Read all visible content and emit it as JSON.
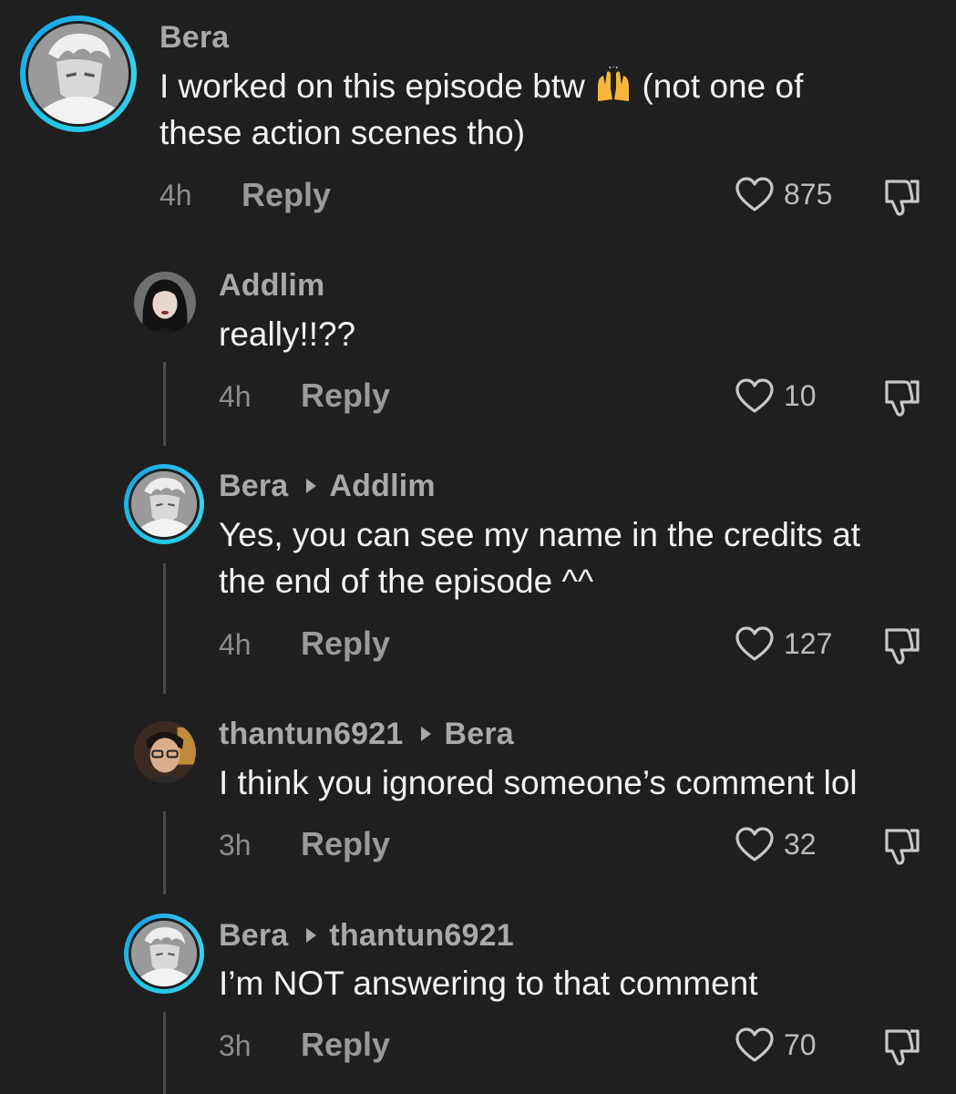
{
  "comments": [
    {
      "user": "Bera",
      "reply_to": "",
      "text_line1": "I worked on this episode btw",
      "emoji": "raising-hands-emoji",
      "text_line1b": "(not one of",
      "text_line2": "these action scenes tho)",
      "time": "4h",
      "reply_label": "Reply",
      "likes": "875"
    },
    {
      "user": "Addlim",
      "text": "really!!??",
      "time": "4h",
      "reply_label": "Reply",
      "likes": "10"
    },
    {
      "user": "Bera",
      "reply_to": "Addlim",
      "text_line1": "Yes, you can see my name in the credits at",
      "text_line2": "the end of the episode ^^",
      "time": "4h",
      "reply_label": "Reply",
      "likes": "127"
    },
    {
      "user": "thantun6921",
      "reply_to": "Bera",
      "text": "I think you ignored someone’s comment lol",
      "time": "3h",
      "reply_label": "Reply",
      "likes": "32"
    },
    {
      "user": "Bera",
      "reply_to": "thantun6921",
      "text": "I’m NOT answering to that comment",
      "time": "3h",
      "reply_label": "Reply",
      "likes": "70"
    }
  ],
  "colors": {
    "background": "#1f1f1f",
    "ring": "#22c8e6",
    "username": "#a9a9a9"
  }
}
